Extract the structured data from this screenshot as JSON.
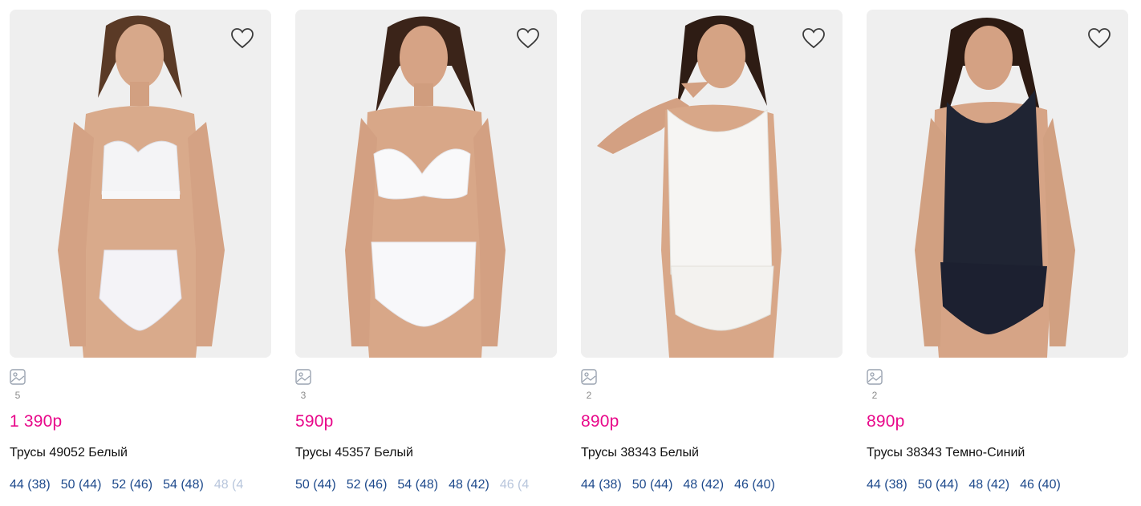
{
  "colors": {
    "price": "#e8088a",
    "size_link": "#1e4a8c",
    "card_bg": "#efefef"
  },
  "icons": {
    "favorite": "heart-outline-icon",
    "gallery": "image-icon"
  },
  "products": [
    {
      "image_count": "5",
      "price": "1 390р",
      "title": "Трусы 49052 Белый",
      "sizes": [
        "44 (38)",
        "50 (44)",
        "52 (46)",
        "54 (48)",
        "48 (4"
      ]
    },
    {
      "image_count": "3",
      "price": "590р",
      "title": "Трусы 45357 Белый",
      "sizes": [
        "50 (44)",
        "52 (46)",
        "54 (48)",
        "48 (42)",
        "46 (4"
      ]
    },
    {
      "image_count": "2",
      "price": "890р",
      "title": "Трусы 38343 Белый",
      "sizes": [
        "44 (38)",
        "50 (44)",
        "48 (42)",
        "46 (40)"
      ]
    },
    {
      "image_count": "2",
      "price": "890р",
      "title": "Трусы 38343 Темно-Синий",
      "sizes": [
        "44 (38)",
        "50 (44)",
        "48 (42)",
        "46 (40)"
      ]
    }
  ]
}
